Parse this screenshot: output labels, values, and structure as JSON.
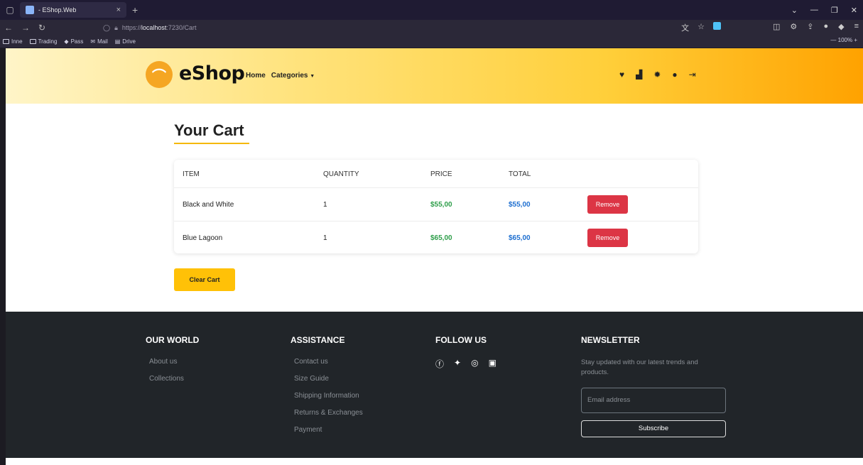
{
  "browser": {
    "tab_title": "- EShop.Web",
    "tab_close": "×",
    "new_tab": "+",
    "url_prefix": "https://",
    "url_host": "localhost",
    "url_path": ":7230/Cart",
    "zoom": "100%",
    "bookmarks": [
      "Inne",
      "Trading",
      "Pass",
      "Mail",
      "Drive"
    ]
  },
  "header": {
    "logo_text": "eShop",
    "nav": {
      "home": "Home",
      "categories": "Categories"
    }
  },
  "cart": {
    "title": "Your Cart",
    "columns": [
      "ITEM",
      "QUANTITY",
      "PRICE",
      "TOTAL"
    ],
    "rows": [
      {
        "item": "Black and White",
        "quantity": "1",
        "price": "$55,00",
        "total": "$55,00",
        "action": "Remove"
      },
      {
        "item": "Blue Lagoon",
        "quantity": "1",
        "price": "$65,00",
        "total": "$65,00",
        "action": "Remove"
      }
    ],
    "clear_label": "Clear Cart"
  },
  "footer": {
    "our_world": {
      "heading": "OUR WORLD",
      "links": [
        "About us",
        "Collections"
      ]
    },
    "assistance": {
      "heading": "ASSISTANCE",
      "links": [
        "Contact us",
        "Size Guide",
        "Shipping Information",
        "Returns & Exchanges",
        "Payment"
      ]
    },
    "follow": {
      "heading": "FOLLOW US",
      "icons": [
        "facebook-icon",
        "twitter-icon",
        "instagram-icon",
        "linkedin-icon"
      ]
    },
    "newsletter": {
      "heading": "NEWSLETTER",
      "text": "Stay updated with our latest trends and products.",
      "email_placeholder": "Email address",
      "subscribe_label": "Subscribe"
    }
  },
  "colors": {
    "accent": "#ffc107",
    "remove": "#dc3545",
    "price": "#2e9e4a",
    "total": "#1e6fd0",
    "footer_bg": "#212529"
  }
}
